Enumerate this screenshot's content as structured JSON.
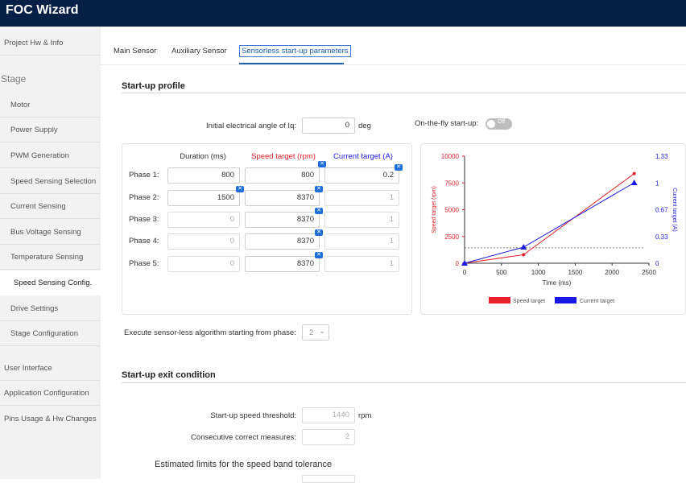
{
  "app": {
    "title": "FOC Wizard"
  },
  "sidebar": {
    "items": [
      {
        "label": "Project Hw & Info"
      },
      {
        "label": "Stage"
      },
      {
        "label": "Motor"
      },
      {
        "label": "Power Supply"
      },
      {
        "label": "PWM Generation"
      },
      {
        "label": "Speed Sensing Selection"
      },
      {
        "label": "Current Sensing"
      },
      {
        "label": "Bus Voltage Sensing"
      },
      {
        "label": "Temperature Sensing"
      },
      {
        "label": "Speed Sensing Config."
      },
      {
        "label": "Drive Settings"
      },
      {
        "label": "Stage Configuration"
      },
      {
        "label": "User Interface"
      },
      {
        "label": "Application Configuration"
      },
      {
        "label": "Pins Usage & Hw Changes"
      }
    ]
  },
  "tabs": [
    {
      "label": "Main Sensor"
    },
    {
      "label": "Auxiliary Sensor"
    },
    {
      "label": "Sensorless start-up parameters"
    }
  ],
  "startup": {
    "title": "Start-up profile",
    "angle_label": "Initial electrical angle of Iq:",
    "angle_value": "0",
    "angle_unit": "deg",
    "fly_label": "On-the-fly start-up:",
    "fly_state": "Off",
    "col_duration": "Duration (ms)",
    "col_speed": "Speed target (rpm)",
    "col_current": "Current target (A)",
    "phases": [
      {
        "label": "Phase 1:",
        "duration": "800",
        "speed": "800",
        "current": "0.2"
      },
      {
        "label": "Phase 2:",
        "duration": "1500",
        "speed": "8370",
        "current": "1"
      },
      {
        "label": "Phase 3:",
        "duration": "0",
        "speed": "8370",
        "current": "1"
      },
      {
        "label": "Phase 4:",
        "duration": "0",
        "speed": "8370",
        "current": "1"
      },
      {
        "label": "Phase 5:",
        "duration": "0",
        "speed": "8370",
        "current": "1"
      }
    ],
    "exec_label": "Execute sensor-less algorithm starting from phase:",
    "exec_value": "2"
  },
  "exit": {
    "title": "Start-up exit condition",
    "threshold_label": "Start-up speed threshold:",
    "threshold_value": "1440",
    "threshold_unit": "rpm",
    "consec_label": "Consecutive correct measures:",
    "consec_value": "2",
    "band_label": "Estimated limits for the speed band tolerance"
  },
  "colors": {
    "header": "#061f47",
    "speed": "#e8212a",
    "current": "#1a1ae6",
    "accent": "#1a5fb4"
  },
  "chart_data": {
    "type": "line",
    "xlabel": "Time (ms)",
    "ylabel_left": "Speed target (rpm)",
    "ylabel_right": "Current target (A)",
    "xlim": [
      0,
      2500
    ],
    "ylim_left": [
      0,
      10000
    ],
    "ylim_right": [
      0,
      1.33
    ],
    "x_ticks": [
      "0",
      "500",
      "1000",
      "1500",
      "2000",
      "2500"
    ],
    "y_left_ticks": [
      "0",
      "2500",
      "5000",
      "7500",
      "10000"
    ],
    "y_right_ticks": [
      "0",
      "0.33",
      "0.67",
      "1",
      "1.33"
    ],
    "series": [
      {
        "name": "Speed target",
        "axis": "left",
        "color": "#e8212a",
        "x": [
          0,
          800,
          2300
        ],
        "y": [
          0,
          800,
          8370
        ]
      },
      {
        "name": "Current target",
        "axis": "right",
        "color": "#1a1ae6",
        "x": [
          0,
          800,
          2300
        ],
        "y": [
          0,
          0.2,
          1
        ]
      }
    ],
    "threshold": {
      "axis": "left",
      "value": 1440
    },
    "legend": "bottom"
  }
}
